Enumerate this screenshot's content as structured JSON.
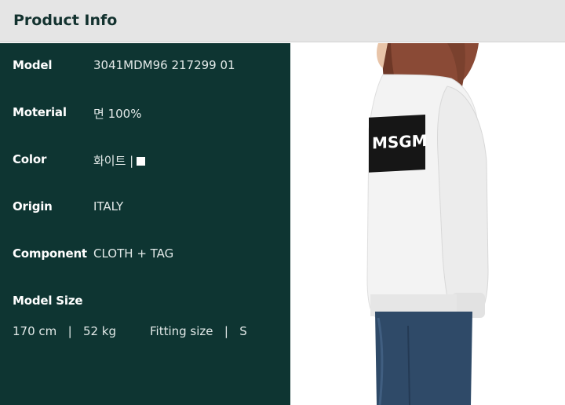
{
  "header": {
    "title": "Product Info"
  },
  "specs": [
    {
      "label": "Model",
      "value": "3041MDM96 217299 01"
    },
    {
      "label": "Moterial",
      "value": "면 100%"
    },
    {
      "label": "Color",
      "value": "화이트 |"
    },
    {
      "label": "Origin",
      "value": "ITALY"
    },
    {
      "label": "Component",
      "value": "CLOTH + TAG"
    }
  ],
  "model_size": {
    "label": "Model Size",
    "height": "170 cm",
    "separator": "|",
    "weight": "52 kg",
    "fitting_label": "Fitting size",
    "fitting_value": "S"
  },
  "colors": {
    "swatch": "#ffffff",
    "panel_bg": "#0e3532",
    "header_bg": "#e5e5e5"
  },
  "photo": {
    "logo_text": "MSGM"
  }
}
